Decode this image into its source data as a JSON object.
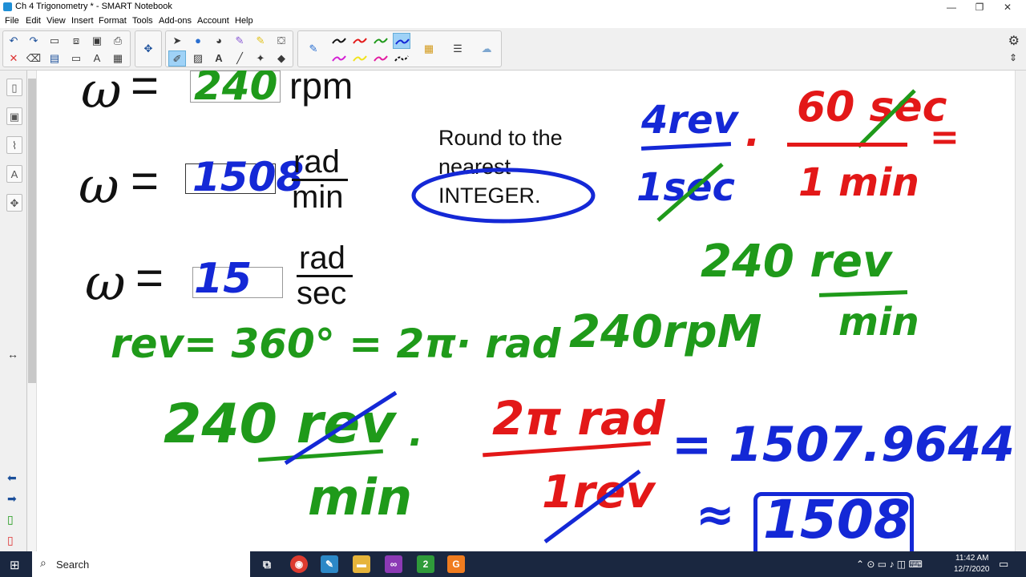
{
  "window": {
    "title": "Ch 4 Trigonometry * - SMART Notebook"
  },
  "menu": [
    "File",
    "Edit",
    "View",
    "Insert",
    "Format",
    "Tools",
    "Add-ons",
    "Account",
    "Help"
  ],
  "canvas": {
    "omega": "ω",
    "equals": "=",
    "line1_answer": "240",
    "line1_unit": "rpm",
    "line2_answer": "1508",
    "line2_unit_top": "rad",
    "line2_unit_bottom": "min",
    "line3_answer": "15",
    "line3_unit_top": "rad",
    "line3_unit_bottom": "sec",
    "note": [
      "Round to the",
      "nearest",
      "INTEGER."
    ],
    "ink": {
      "rev_eq": "rev= 360° = 2π· rad",
      "conv_top_left": "4rev",
      "conv_bottom_left": "1sec",
      "dot1": "·",
      "conv_top_right": "60 sec",
      "conv_bottom_right": "1 min",
      "eq_right": "=",
      "rpm_top": "240 rev",
      "rpm_bottom": "min",
      "rpm_alt": "240rpM",
      "big_num": "240 rev",
      "big_den": "min",
      "dot2": "·",
      "big2_num": "2π rad",
      "big2_den": "1rev",
      "result": "= 1507.9644...",
      "approx": "≈",
      "boxed": "1508"
    }
  },
  "colors": {
    "green": "#1f9a1a",
    "blue": "#1428d6",
    "red": "#e31818",
    "text": "#111111"
  },
  "taskbar": {
    "search_label": "Search",
    "time": "11:42 AM",
    "date": "12/7/2020"
  }
}
